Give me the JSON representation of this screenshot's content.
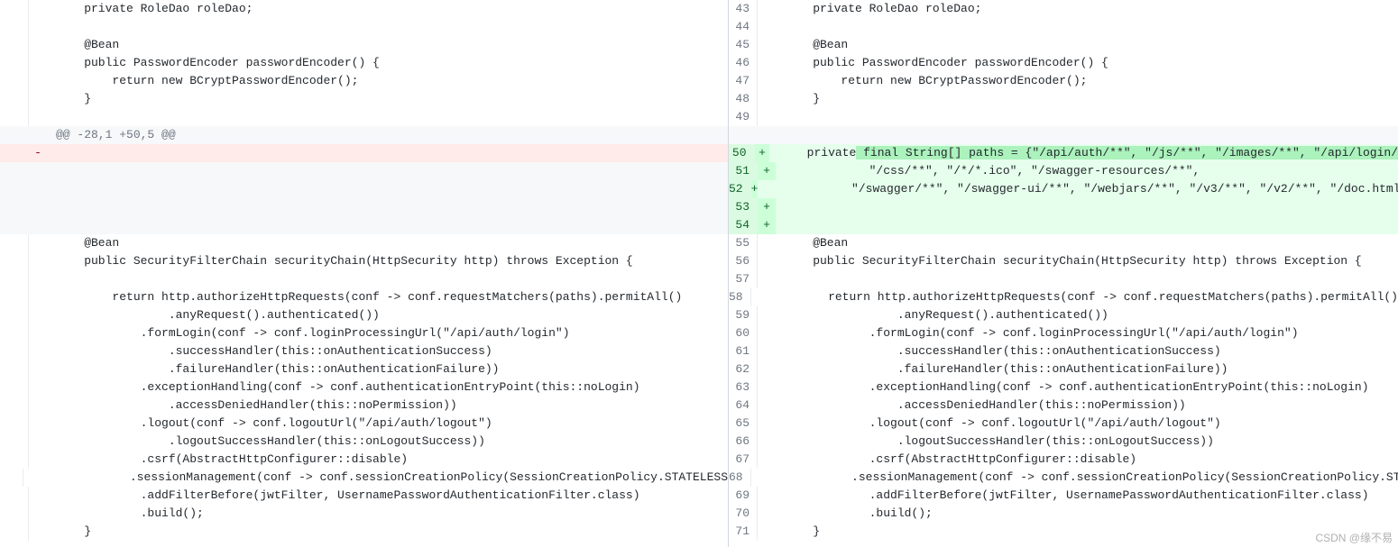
{
  "hunk_header": "@@ -28,1 +50,5 @@",
  "ctx_top": [
    "    private RoleDao roleDao;",
    "",
    "    @Bean",
    "    public PasswordEncoder passwordEncoder() {",
    "        return new BCryptPasswordEncoder();",
    "    }",
    ""
  ],
  "left_del": [
    ""
  ],
  "right_add_first_plain": "    private",
  "right_add_first_hl": " final String[] paths = {\"/api/auth/**\", \"/js/**\", \"/images/**\", \"/api/login/",
  "right_add_rest": [
    "            \"/css/**\", \"/*/*.ico\", \"/swagger-resources/**\",",
    "            \"/swagger/**\", \"/swagger-ui/**\", \"/webjars/**\", \"/v3/**\", \"/v2/**\", \"/doc.html/*",
    "",
    ""
  ],
  "ctx_bot": [
    "    @Bean",
    "    public SecurityFilterChain securityChain(HttpSecurity http) throws Exception {",
    "",
    "        return http.authorizeHttpRequests(conf -> conf.requestMatchers(paths).permitAll()",
    "                .anyRequest().authenticated())",
    "            .formLogin(conf -> conf.loginProcessingUrl(\"/api/auth/login\")",
    "                .successHandler(this::onAuthenticationSuccess)",
    "                .failureHandler(this::onAuthenticationFailure))",
    "            .exceptionHandling(conf -> conf.authenticationEntryPoint(this::noLogin)",
    "                .accessDeniedHandler(this::noPermission))",
    "            .logout(conf -> conf.logoutUrl(\"/api/auth/logout\")",
    "                .logoutSuccessHandler(this::onLogoutSuccess))",
    "            .csrf(AbstractHttpConfigurer::disable)",
    "            .sessionManagement(conf -> conf.sessionCreationPolicy(SessionCreationPolicy.STATELESS",
    "            .addFilterBefore(jwtFilter, UsernamePasswordAuthenticationFilter.class)",
    "            .build();",
    "    }"
  ],
  "right_ctx_bot_session": "            .sessionManagement(conf -> conf.sessionCreationPolicy(SessionCreationPolicy.ST",
  "right_first_num": 43,
  "right_add_first_num": 50,
  "right_bot_first_num": 55,
  "watermark": "CSDN @缘不易"
}
